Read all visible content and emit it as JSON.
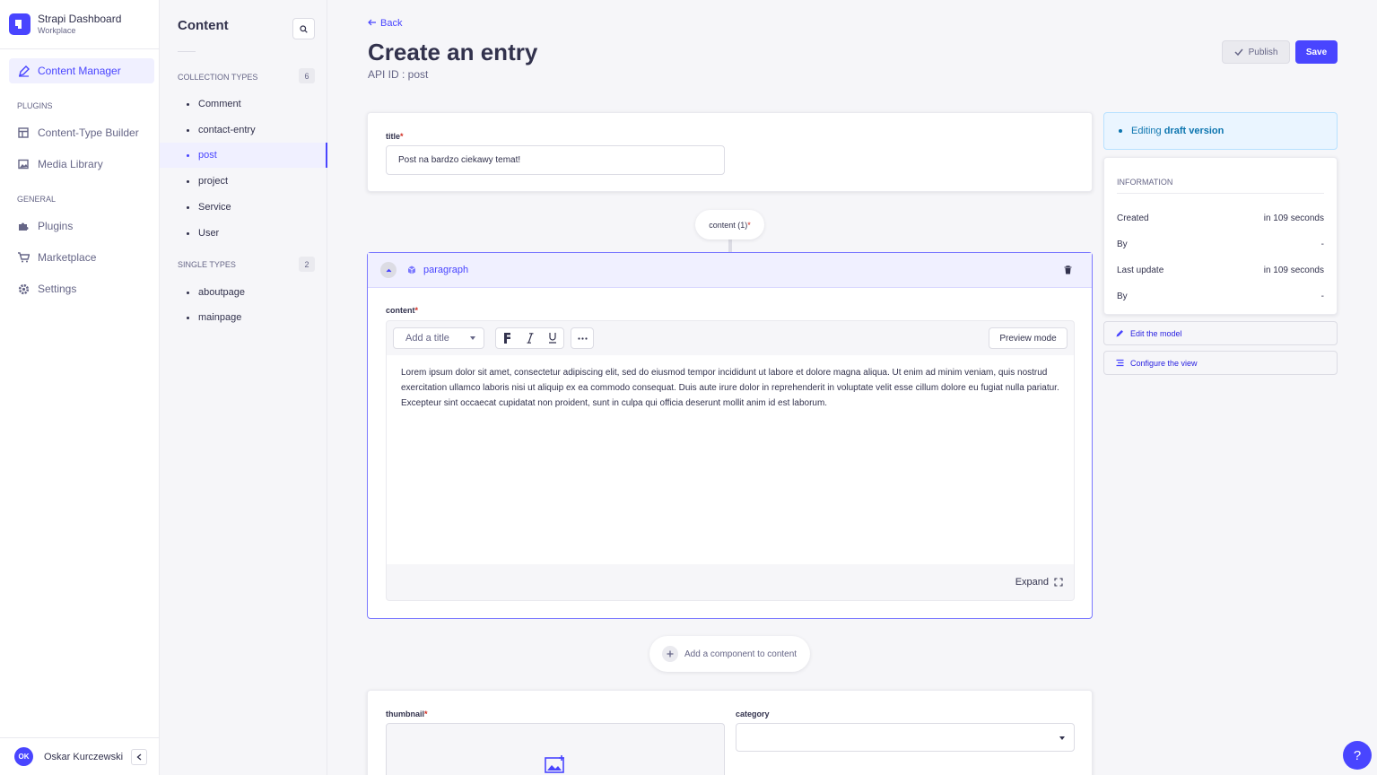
{
  "brand": {
    "title": "Strapi Dashboard",
    "subtitle": "Workplace"
  },
  "mainnav": {
    "content_manager": "Content Manager",
    "plugins_section": "PLUGINS",
    "content_type_builder": "Content-Type Builder",
    "media_library": "Media Library",
    "general_section": "GENERAL",
    "plugins": "Plugins",
    "marketplace": "Marketplace",
    "settings": "Settings"
  },
  "user": {
    "initials": "OK",
    "name": "Oskar Kurczewski"
  },
  "subnav": {
    "title": "Content",
    "collection_label": "COLLECTION TYPES",
    "collection_count": "6",
    "collection_items": [
      "Comment",
      "contact-entry",
      "post",
      "project",
      "Service",
      "User"
    ],
    "single_label": "SINGLE TYPES",
    "single_count": "2",
    "single_items": [
      "aboutpage",
      "mainpage"
    ]
  },
  "header": {
    "back": "Back",
    "title": "Create an entry",
    "api_id": "API ID : post",
    "publish": "Publish",
    "save": "Save"
  },
  "form": {
    "title_label": "title",
    "title_value": "Post na bardzo ciekawy temat!",
    "zone_label": "content (1)",
    "component_name": "paragraph",
    "content_label": "content",
    "add_title": "Add a title",
    "preview_mode": "Preview mode",
    "content_text": "Lorem ipsum dolor sit amet, consectetur adipiscing elit, sed do eiusmod tempor incididunt ut labore et dolore magna aliqua. Ut enim ad minim veniam, quis nostrud exercitation ullamco laboris nisi ut aliquip ex ea commodo consequat. Duis aute irure dolor in reprehenderit in voluptate velit esse cillum dolore eu fugiat nulla pariatur. Excepteur sint occaecat cupidatat non proident, sunt in culpa qui officia deserunt mollit anim id est laborum.",
    "expand": "Expand",
    "add_component": "Add a component to content",
    "thumbnail_label": "thumbnail",
    "category_label": "category"
  },
  "sidebar": {
    "draft_prefix": "Editing ",
    "draft_bold": "draft version",
    "info_title": "INFORMATION",
    "created_label": "Created",
    "created_value": "in 109 seconds",
    "by1_label": "By",
    "by1_value": "-",
    "updated_label": "Last update",
    "updated_value": "in 109 seconds",
    "by2_label": "By",
    "by2_value": "-",
    "edit_model": "Edit the model",
    "configure_view": "Configure the view"
  },
  "help": "?",
  "colors": {
    "primary": "#4945ff",
    "required": "#d02b20",
    "draft": "#0c75af"
  }
}
